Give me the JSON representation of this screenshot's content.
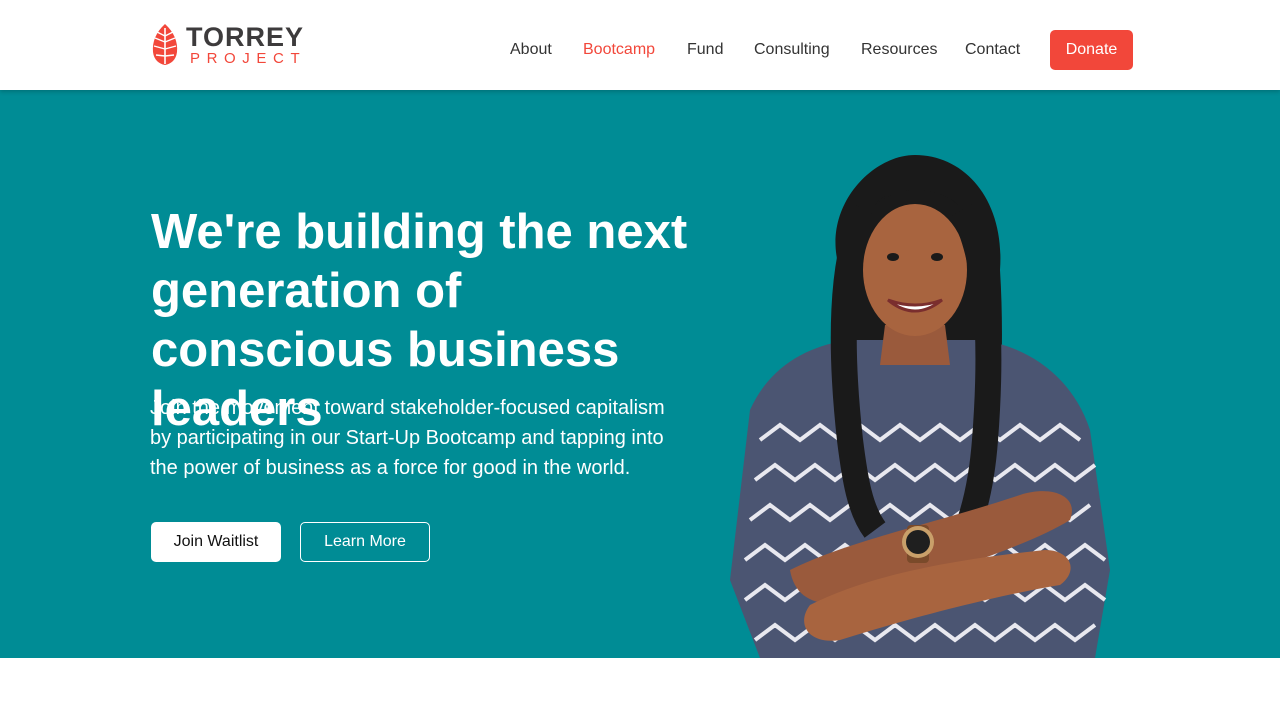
{
  "brand": {
    "name": "TORREY",
    "subname": "PROJECT",
    "colors": {
      "accent": "#f2473a",
      "teal": "#008c95",
      "text_dark": "#333333"
    },
    "logo_icon": "leaf-icon"
  },
  "nav": {
    "items": [
      {
        "label": "About",
        "active": false
      },
      {
        "label": "Bootcamp",
        "active": true
      },
      {
        "label": "Fund",
        "active": false
      },
      {
        "label": "Consulting",
        "active": false
      },
      {
        "label": "Resources",
        "active": false
      },
      {
        "label": "Contact",
        "active": false
      }
    ],
    "donate_label": "Donate"
  },
  "hero": {
    "title": "We're building the next generation of conscious business leaders",
    "text": "Join the movement toward stakeholder-focused capitalism by participating in our Start-Up Bootcamp and tapping into the power of business as a force for good in the world.",
    "primary_button": "Join Waitlist",
    "secondary_button": "Learn More",
    "photo": "portrait-photo"
  }
}
